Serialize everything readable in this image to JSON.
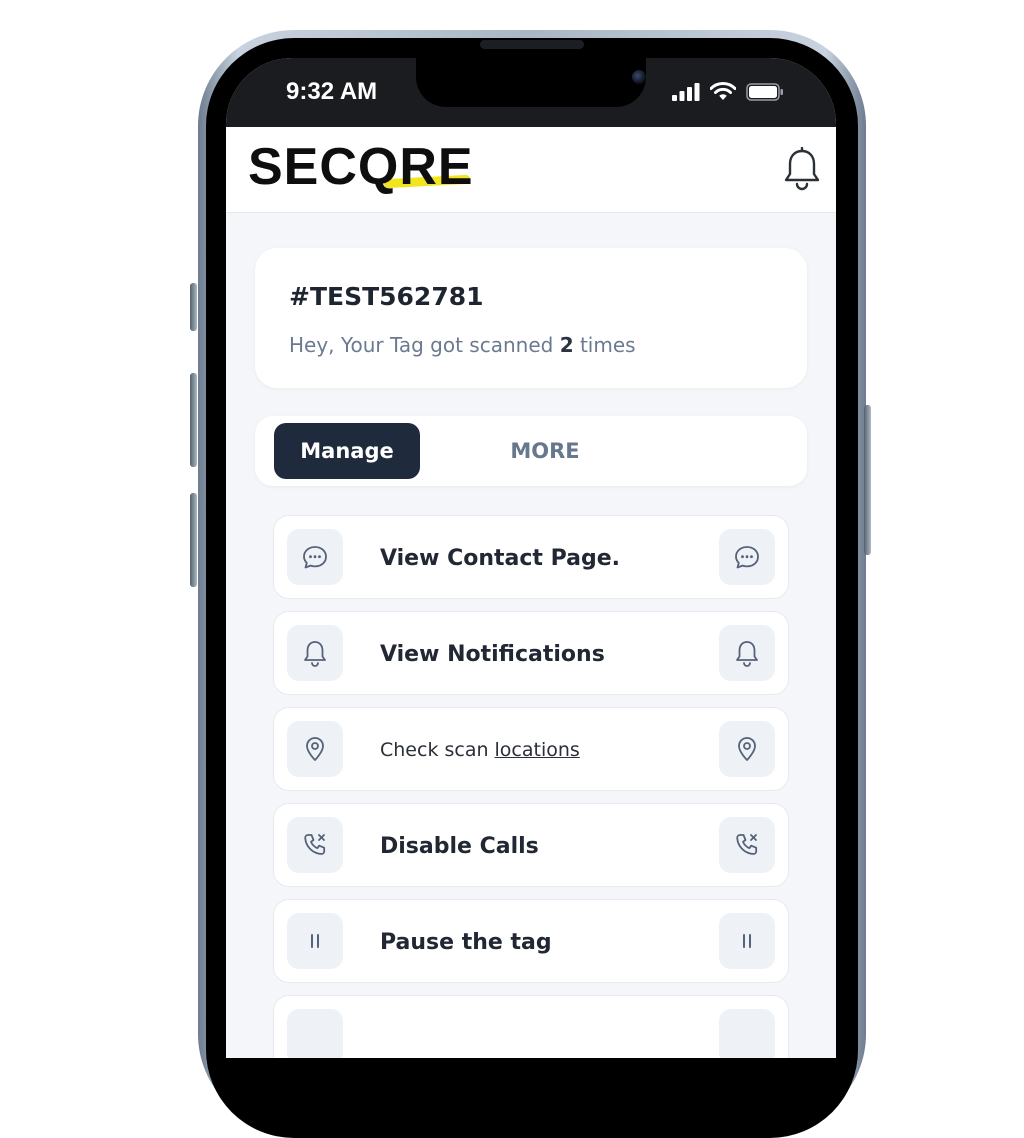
{
  "status_bar": {
    "time": "9:32 AM"
  },
  "header": {
    "logo": "SECQRE",
    "accent_color": "#f2e41d"
  },
  "info_card": {
    "tag_id": "#TEST562781",
    "scan_prefix": "Hey, Your Tag got scanned",
    "scan_count": "2",
    "scan_suffix": "times"
  },
  "tabs": {
    "active": "Manage",
    "manage_label": "Manage",
    "more_label": "MORE"
  },
  "actions": {
    "items": [
      {
        "label": "View Contact Page.",
        "icon": "chat-bubble-icon"
      },
      {
        "label": "View Notifications",
        "icon": "bell-icon"
      },
      {
        "label_prefix": "Check scan",
        "label_link": "locations",
        "icon": "location-pin-icon"
      },
      {
        "label": "Disable Calls",
        "icon": "phone-off-icon"
      },
      {
        "label": "Pause the tag",
        "icon": "pause-icon"
      }
    ]
  },
  "colors": {
    "primary_dark": "#1f2b3d",
    "muted_text": "#6b7a90",
    "background": "#f4f6f9"
  }
}
